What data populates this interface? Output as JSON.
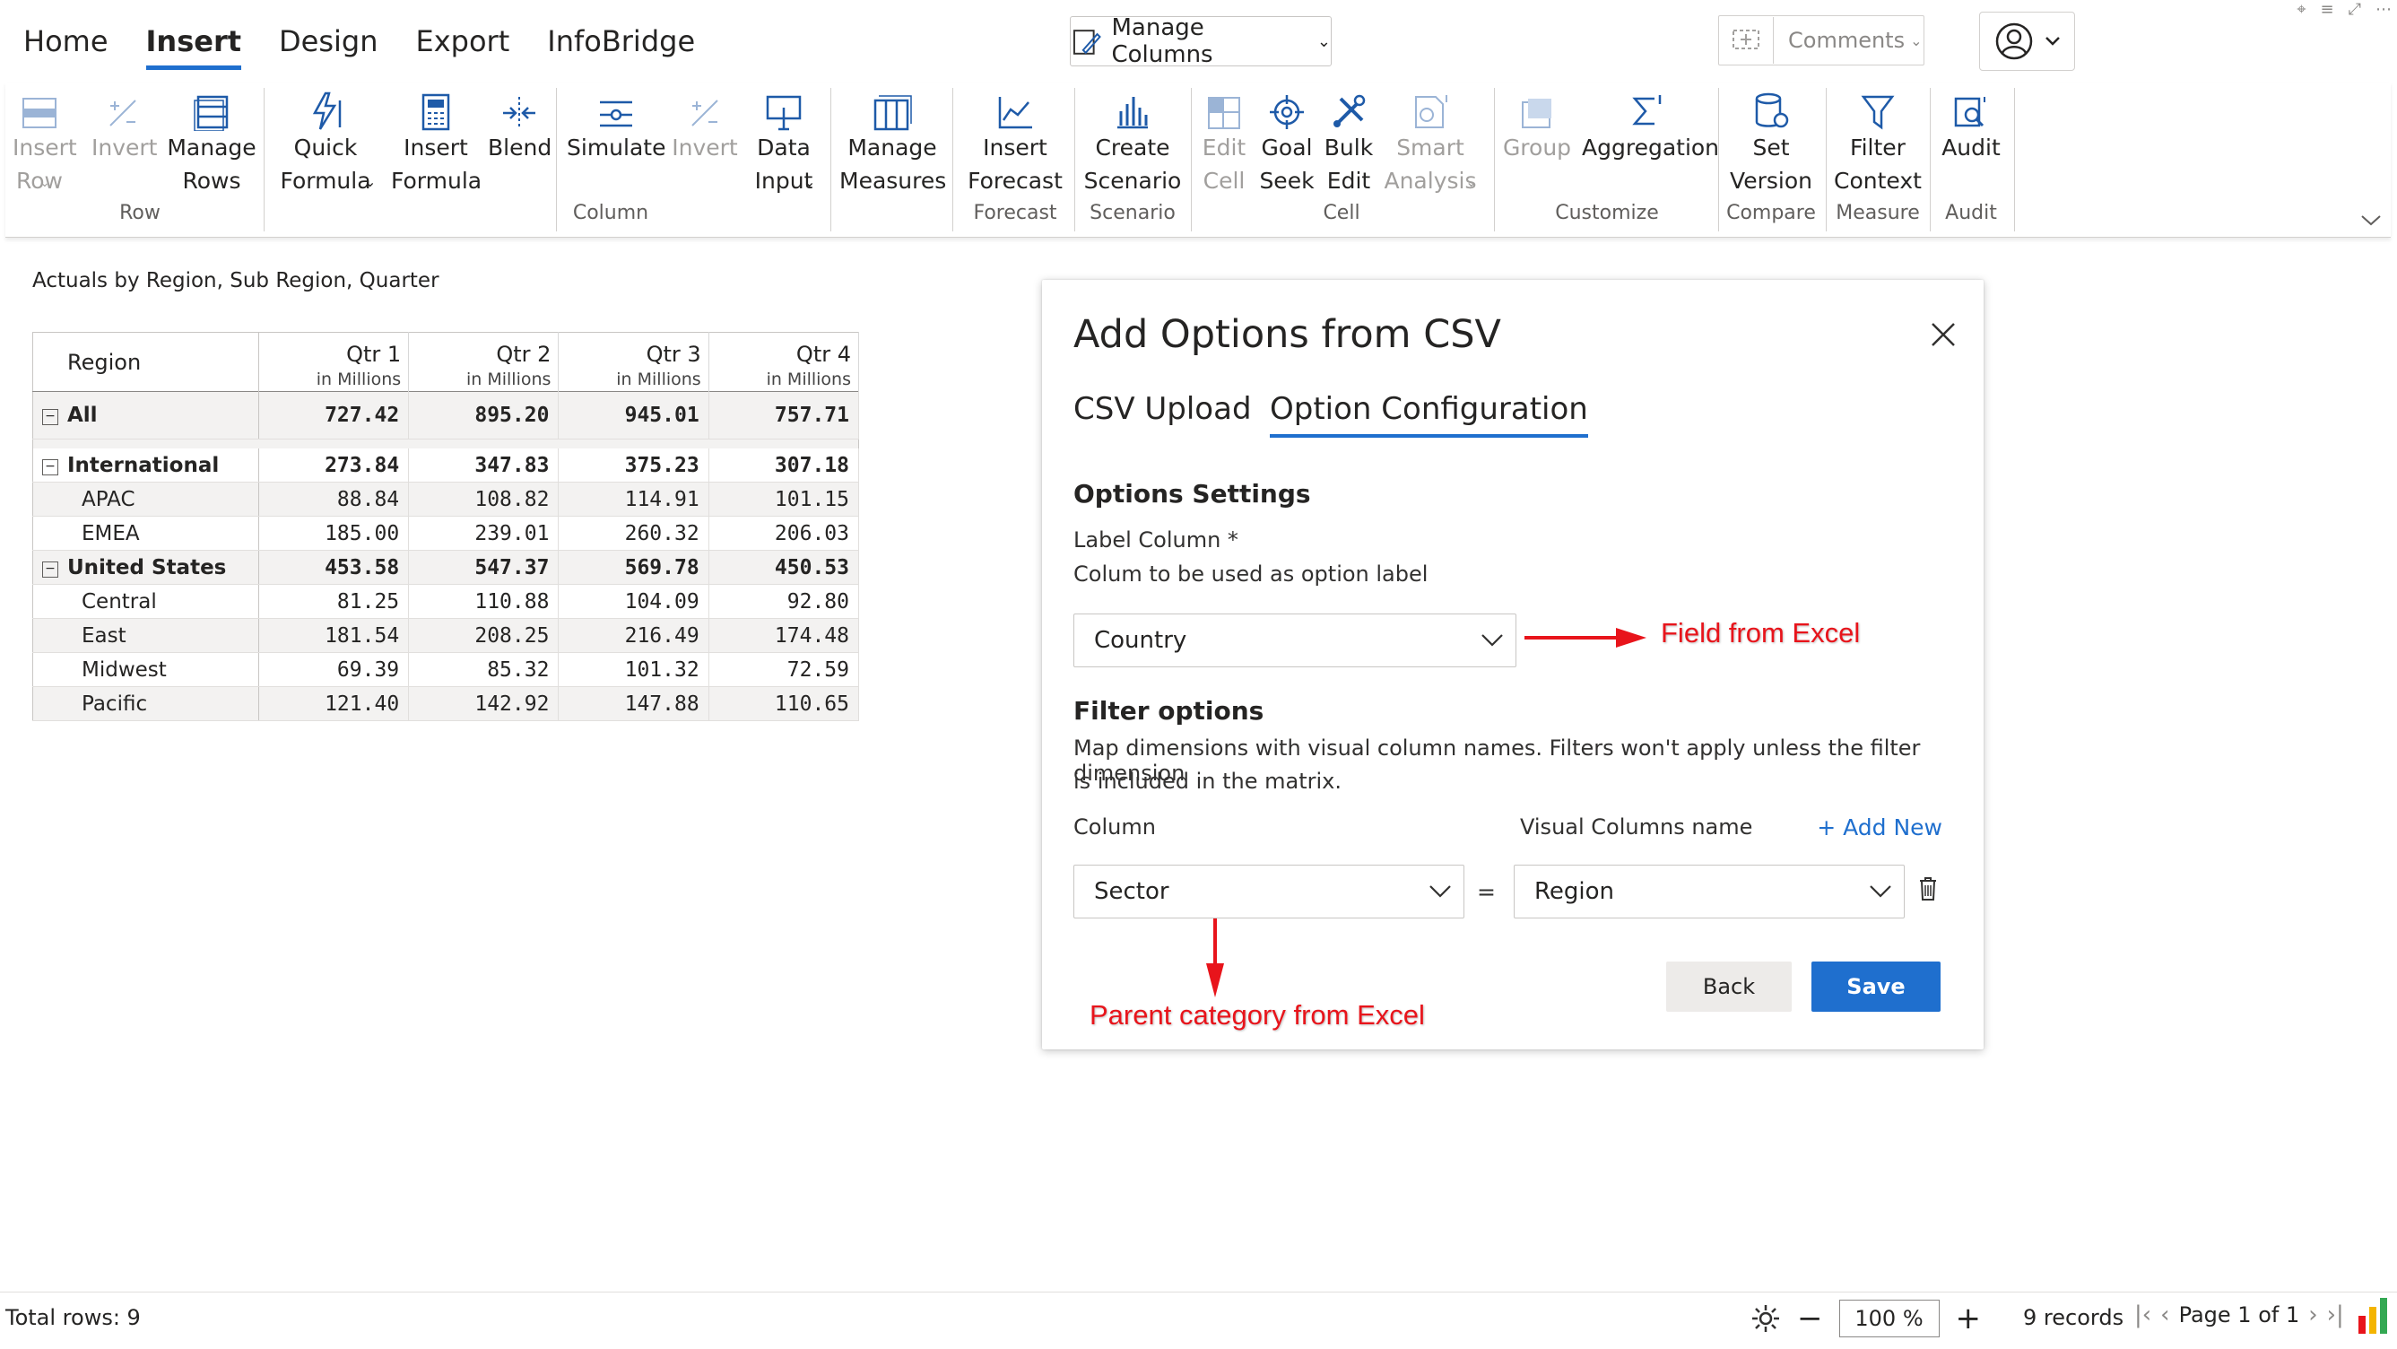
{
  "menu": {
    "tabs": [
      {
        "label": "Home",
        "active": false
      },
      {
        "label": "Insert",
        "active": true
      },
      {
        "label": "Design",
        "active": false
      },
      {
        "label": "Export",
        "active": false
      },
      {
        "label": "InfoBridge",
        "active": false
      }
    ],
    "manage_columns": "Manage Columns",
    "comments": "Comments"
  },
  "ribbon": {
    "buttons": {
      "insert_row": "Insert\nRow",
      "invert_row": "Invert",
      "manage_rows": "Manage\nRows",
      "quick_formula": "Quick\nFormula",
      "insert_formula": "Insert\nFormula",
      "blend": "Blend",
      "simulate": "Simulate",
      "invert_col": "Invert",
      "data_input": "Data\nInput",
      "manage_measures": "Manage\nMeasures",
      "insert_forecast": "Insert\nForecast",
      "create_scenario": "Create\nScenario",
      "edit_cell": "Edit\nCell",
      "goal_seek": "Goal\nSeek",
      "bulk_edit": "Bulk\nEdit",
      "smart_analysis": "Smart\nAnalysis",
      "group": "Group",
      "aggregation": "Aggregation",
      "set_version": "Set\nVersion",
      "filter_context": "Filter\nContext",
      "audit": "Audit"
    },
    "groups": {
      "row": "Row",
      "column": "Column",
      "forecast": "Forecast",
      "scenario": "Scenario",
      "cell": "Cell",
      "customize": "Customize",
      "compare": "Compare",
      "measure": "Measure",
      "audit": "Audit"
    }
  },
  "grid": {
    "title": "Actuals by Region, Sub Region, Quarter",
    "region_header": "Region",
    "columns": [
      {
        "label": "Qtr 1",
        "unit": "in Millions"
      },
      {
        "label": "Qtr 2",
        "unit": "in Millions"
      },
      {
        "label": "Qtr 3",
        "unit": "in Millions"
      },
      {
        "label": "Qtr 4",
        "unit": "in Millions"
      }
    ],
    "rows": [
      {
        "label": "All",
        "values": [
          "727.42",
          "895.20",
          "945.01",
          "757.71"
        ]
      },
      {
        "label": "International",
        "values": [
          "273.84",
          "347.83",
          "375.23",
          "307.18"
        ]
      },
      {
        "label": "APAC",
        "values": [
          "88.84",
          "108.82",
          "114.91",
          "101.15"
        ]
      },
      {
        "label": "EMEA",
        "values": [
          "185.00",
          "239.01",
          "260.32",
          "206.03"
        ]
      },
      {
        "label": "United States",
        "values": [
          "453.58",
          "547.37",
          "569.78",
          "450.53"
        ]
      },
      {
        "label": "Central",
        "values": [
          "81.25",
          "110.88",
          "104.09",
          "92.80"
        ]
      },
      {
        "label": "East",
        "values": [
          "181.54",
          "208.25",
          "216.49",
          "174.48"
        ]
      },
      {
        "label": "Midwest",
        "values": [
          "69.39",
          "85.32",
          "101.32",
          "72.59"
        ]
      },
      {
        "label": "Pacific",
        "values": [
          "121.40",
          "142.92",
          "147.88",
          "110.65"
        ]
      }
    ]
  },
  "dialog": {
    "title": "Add Options from CSV",
    "tabs": [
      "CSV Upload",
      "Option Configuration"
    ],
    "options_settings": "Options Settings",
    "label_column": "Label Column *",
    "label_column_help": "Colum to be used as option label",
    "label_value": "Country",
    "filter_options": "Filter options",
    "filter_help_1": "Map dimensions with visual column names. Filters won't apply unless the filter dimension",
    "filter_help_2": "is included in the matrix.",
    "column_header": "Column",
    "visual_header": "Visual Columns name",
    "add_new": "+ Add New",
    "column_value": "Sector",
    "equals": "=",
    "visual_value": "Region",
    "back": "Back",
    "save": "Save"
  },
  "annotations": {
    "field_from_excel": "Field from Excel",
    "parent_category": "Parent category from Excel"
  },
  "status": {
    "total_rows": "Total rows: 9",
    "zoom": "100 %",
    "records": "9 records",
    "page": "Page 1 of 1"
  },
  "colors": {
    "accent": "#1f6fce",
    "annotation": "#e8141b",
    "ribbon_icon": "#1e5aa8"
  }
}
